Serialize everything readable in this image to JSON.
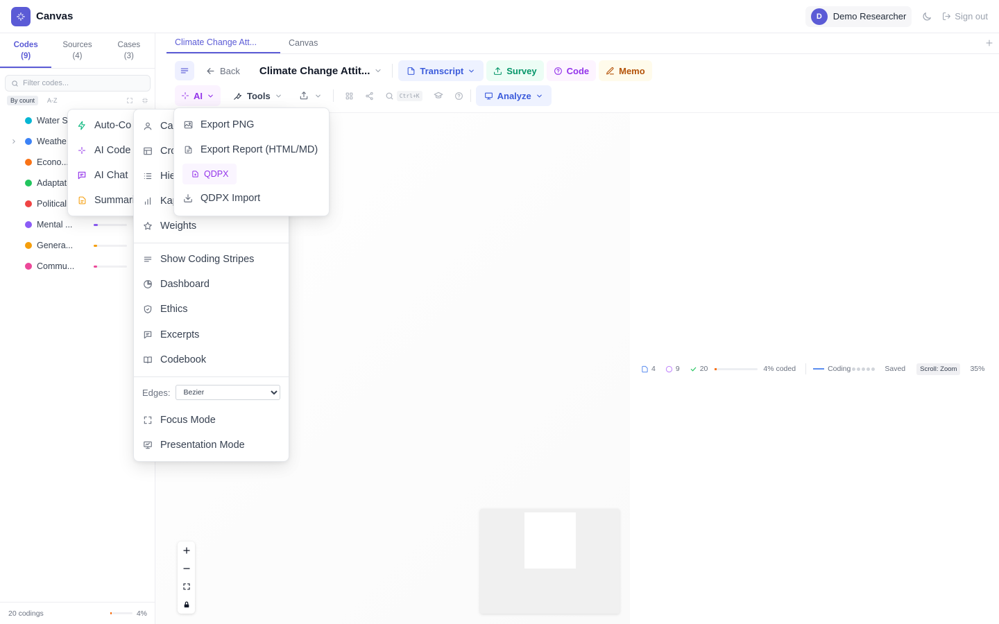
{
  "app": {
    "title": "Canvas"
  },
  "header": {
    "user_initial": "D",
    "user_name": "Demo Researcher",
    "sign_out": "Sign out"
  },
  "sidebar": {
    "tabs": [
      {
        "label": "Codes",
        "count": "(9)"
      },
      {
        "label": "Sources",
        "count": "(4)"
      },
      {
        "label": "Cases",
        "count": "(3)"
      }
    ],
    "filter_placeholder": "Filter codes...",
    "sort_by_count": "By count",
    "sort_az": "A-Z",
    "codes": [
      {
        "name": "Water S",
        "color": "#06b6d4",
        "fill": 0
      },
      {
        "name": "Weathe...",
        "color": "#3b82f6",
        "fill": 0
      },
      {
        "name": "Econo...",
        "color": "#f97316",
        "fill": 0
      },
      {
        "name": "Adaptat",
        "color": "#22c55e",
        "fill": 0
      },
      {
        "name": "Political",
        "color": "#ef4444",
        "fill": 0
      },
      {
        "name": "Mental ...",
        "color": "#8b5cf6",
        "fill": 0.12
      },
      {
        "name": "Genera...",
        "color": "#f59e0b",
        "fill": 0.1
      },
      {
        "name": "Commu...",
        "color": "#ec4899",
        "fill": 0.1
      }
    ],
    "footer_codings": "20 codings",
    "footer_percent": "4%",
    "footer_fill": 0.04
  },
  "doc_tabs": [
    {
      "label": "Climate Change Att..."
    },
    {
      "label": "Canvas"
    }
  ],
  "toolbar": {
    "back": "Back",
    "doc_title": "Climate Change Attit...",
    "transcript": "Transcript",
    "survey": "Survey",
    "code": "Code",
    "memo": "Memo",
    "ai": "AI",
    "tools": "Tools",
    "search_shortcut": "Ctrl+K",
    "analyze": "Analyze"
  },
  "ai_menu": {
    "items": [
      "Auto-Co",
      "AI Code",
      "AI Chat",
      "Summari"
    ]
  },
  "tools_menu": {
    "items_top": [
      "Ca",
      "Cro",
      "Hie",
      "Kap",
      "Weights"
    ],
    "items_mid": [
      "Show Coding Stripes",
      "Dashboard",
      "Ethics",
      "Excerpts",
      "Codebook"
    ],
    "edges_label": "Edges:",
    "edges_value": "Bezier",
    "items_bottom": [
      "Focus Mode",
      "Presentation Mode"
    ]
  },
  "export_menu": {
    "export_png": "Export PNG",
    "export_report": "Export Report (HTML/MD)",
    "qdpx": "QDPX",
    "qdpx_import": "QDPX Import"
  },
  "status": {
    "sources": "4",
    "memos": "9",
    "codings": "20",
    "coded": "4% coded",
    "coded_fill": 0.04,
    "coding_label": "Coding",
    "saved": "Saved",
    "scroll": "Scroll: Zoom",
    "zoom": "35%"
  },
  "colors": {
    "accent": "#5b5bd6",
    "ai": "#9333ea",
    "survey": "#059669",
    "memo": "#b45309"
  }
}
